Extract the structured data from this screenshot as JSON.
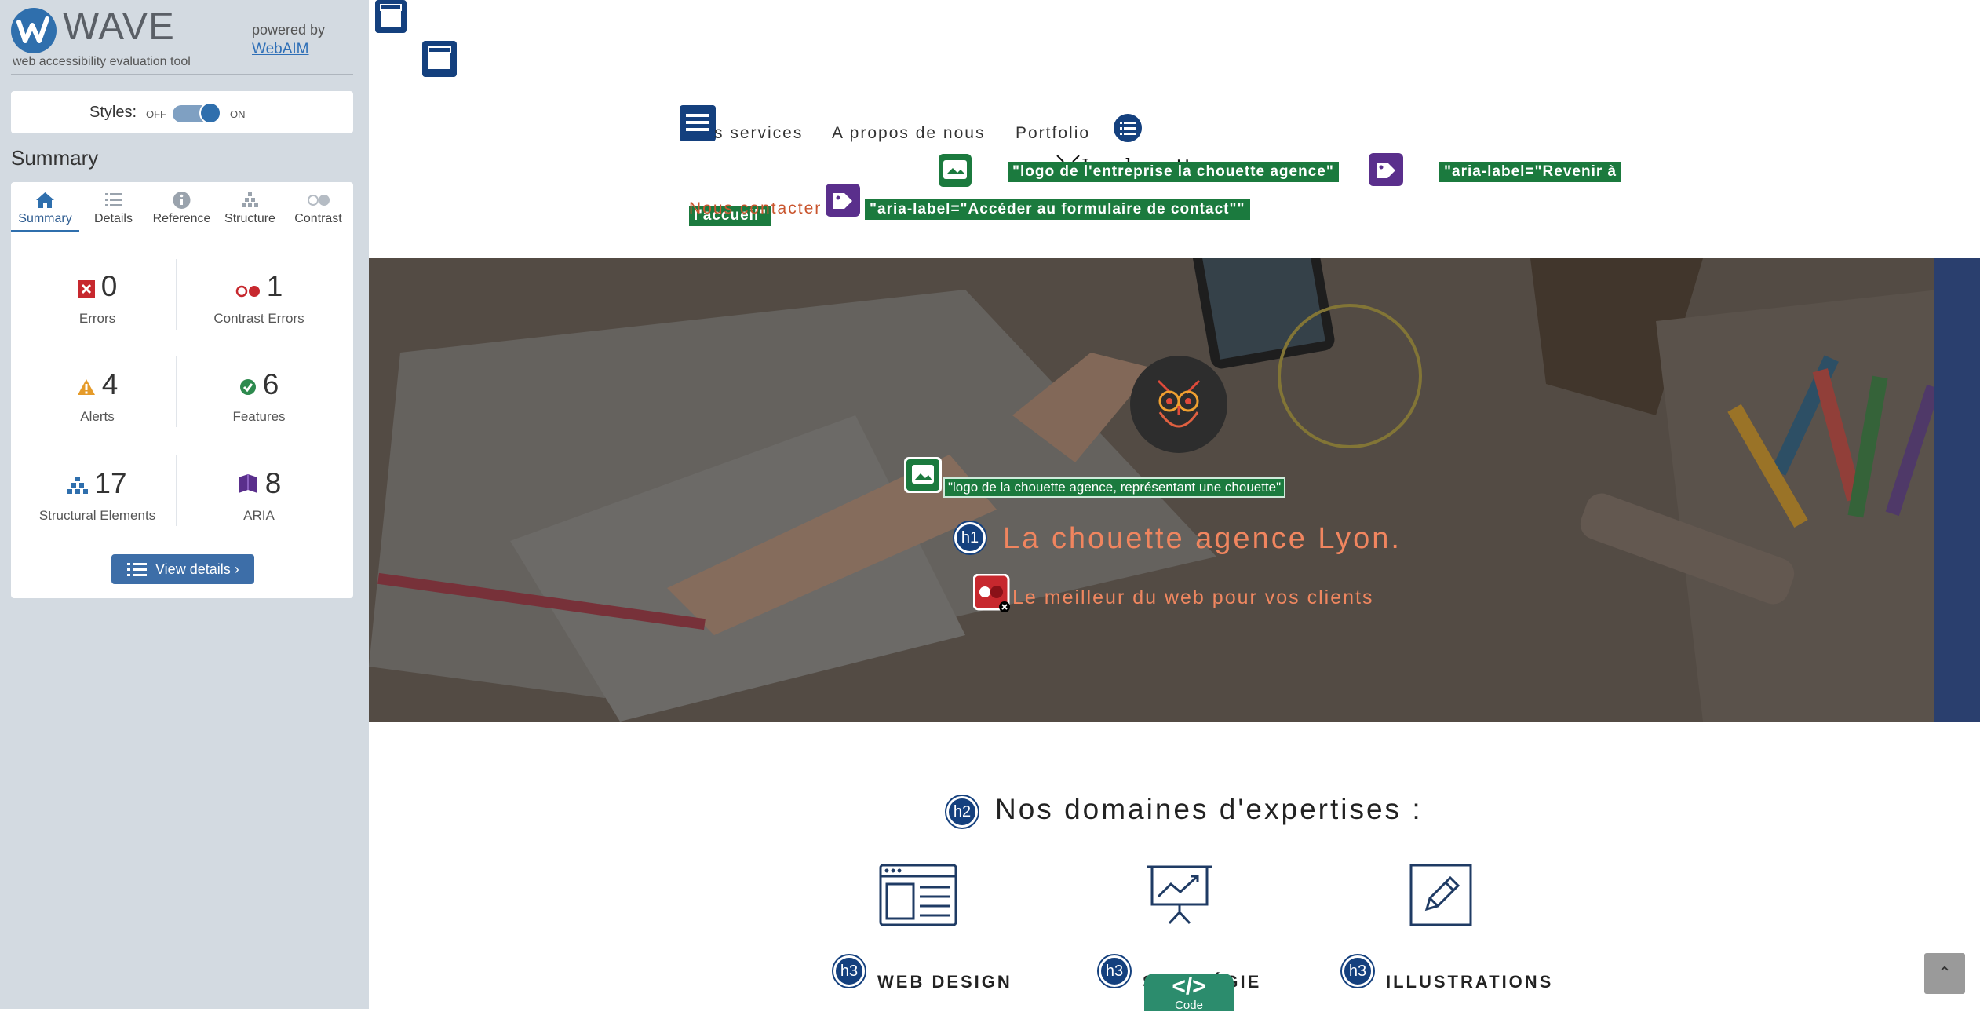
{
  "wave": {
    "title": "WAVE",
    "subtitle": "web accessibility evaluation tool",
    "powered_by": "powered by",
    "webaim_link": "WebAIM",
    "styles_label": "Styles:",
    "styles_off": "OFF",
    "styles_on": "ON",
    "summary_heading": "Summary",
    "tabs": [
      {
        "label": "Summary",
        "icon": "home-icon",
        "active": true
      },
      {
        "label": "Details",
        "icon": "list-icon"
      },
      {
        "label": "Reference",
        "icon": "info-icon"
      },
      {
        "label": "Structure",
        "icon": "structure-icon"
      },
      {
        "label": "Contrast",
        "icon": "contrast-icon"
      }
    ],
    "stats": {
      "errors": {
        "count": "0",
        "label": "Errors",
        "color": "#c7282e"
      },
      "contrast_errors": {
        "count": "1",
        "label": "Contrast Errors",
        "color": "#c7282e"
      },
      "alerts": {
        "count": "4",
        "label": "Alerts",
        "color": "#e59b2a"
      },
      "features": {
        "count": "6",
        "label": "Features",
        "color": "#2d8a4e"
      },
      "structural": {
        "count": "17",
        "label": "Structural Elements",
        "color": "#2f6fad"
      },
      "aria": {
        "count": "8",
        "label": "ARIA",
        "color": "#5a2f8c"
      }
    },
    "view_details": "View details ›"
  },
  "site": {
    "nav": {
      "services": "s services",
      "about": "A propos de nous",
      "portfolio": "Portfolio",
      "contact": "Nous contacter"
    },
    "brand": "La chouette agence",
    "aria_tags": {
      "logo_alt": "\"logo de l'entreprise la chouette agence\"",
      "home_label_a": "\"aria-label=\"Revenir à",
      "home_label_b": "l'accueil\"",
      "contact_label": "\"aria-label=\"Accéder au formulaire de contact\"\""
    },
    "hero": {
      "img_alt": "\"logo de la chouette agence, représentant une chouette\"",
      "h1": "La chouette agence Lyon.",
      "subtitle": "Le meilleur du web pour vos clients"
    },
    "expertise": {
      "heading": "Nos domaines d'expertises :",
      "items": [
        {
          "title": "WEB DESIGN",
          "icon": "web-layout-icon"
        },
        {
          "title": "STRATÉGIE",
          "icon": "presentation-chart-icon"
        },
        {
          "title": "ILLUSTRATIONS",
          "icon": "pencil-icon"
        }
      ]
    },
    "badges": {
      "h1": "h1",
      "h2": "h2",
      "h3": "h3"
    },
    "code_button": {
      "symbol": "</>",
      "label": "Code"
    },
    "scroll_top": "⌃"
  }
}
